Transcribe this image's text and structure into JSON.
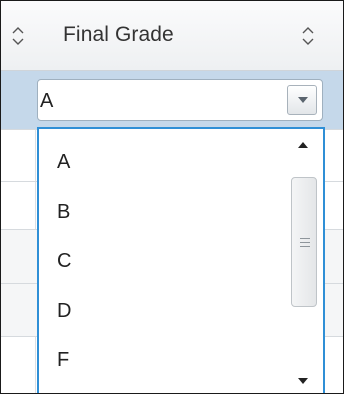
{
  "header": {
    "title": "Final Grade"
  },
  "combo": {
    "value": "A"
  },
  "dropdown": {
    "options": [
      "A",
      "B",
      "C",
      "D",
      "F"
    ]
  },
  "colors": {
    "selected_row": "#c5d8ea",
    "dropdown_border": "#2f8fd6"
  }
}
